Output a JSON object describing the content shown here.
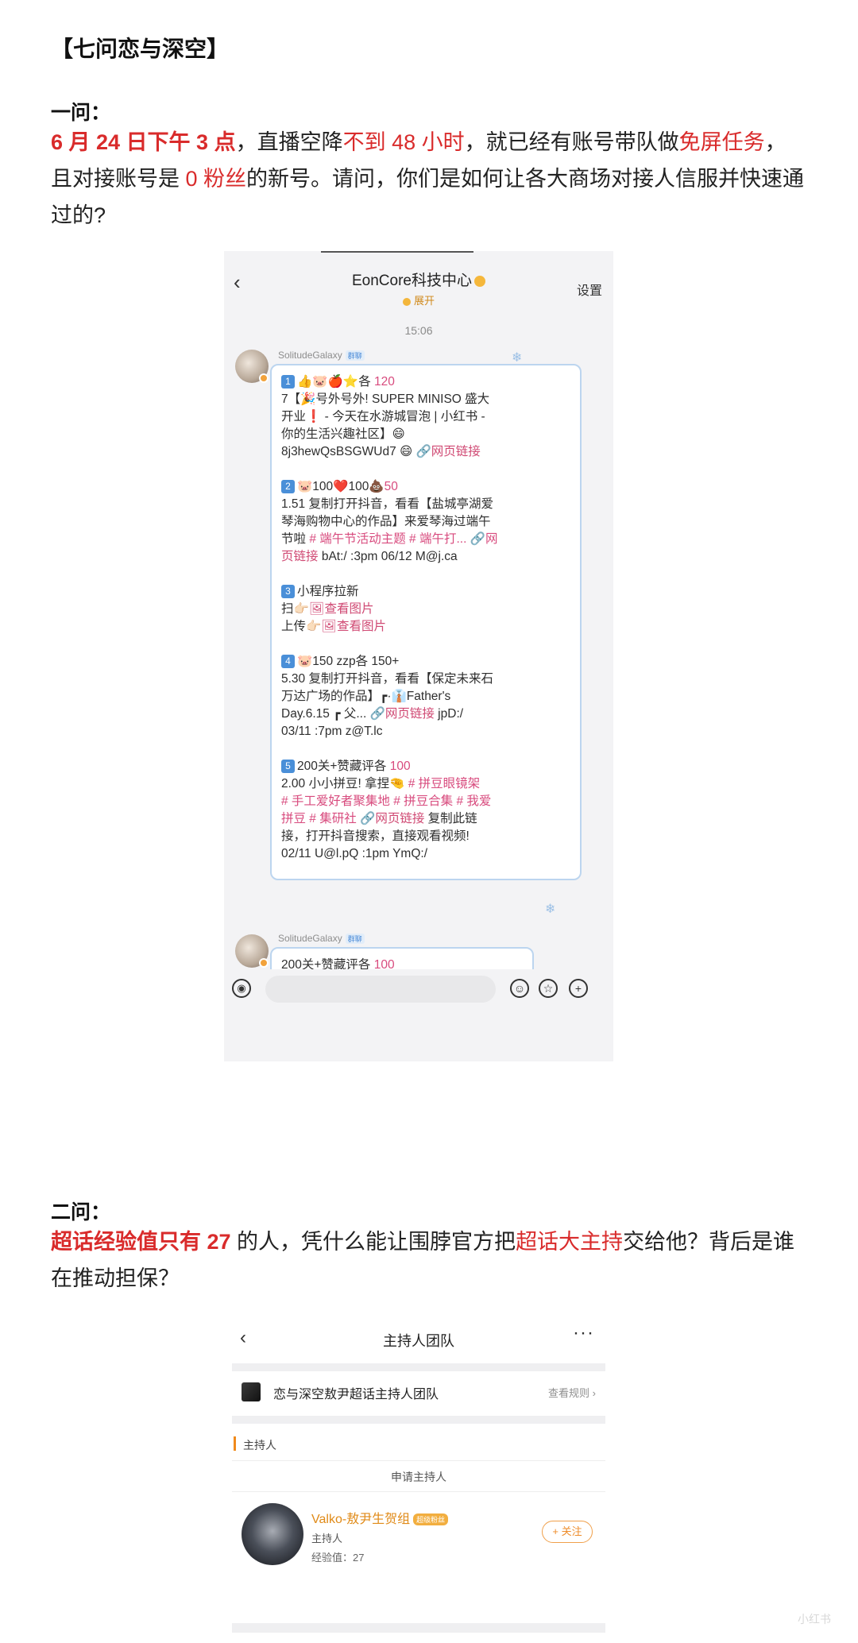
{
  "doc": {
    "title": "【七问恋与深空】"
  },
  "q1": {
    "heading": "一问：",
    "p1": "6 月 24 日下午 3 点",
    "p2": "，直播空降",
    "p3": "不到 48 小时",
    "p4": "，就已经有账号带队做",
    "p5": "免屏任务",
    "p6": "，",
    "p7": "且对接账号是 ",
    "p8": "0 粉丝",
    "p9": "的新号。请问，你们是如何让各大商场对接人信服并快速通",
    "p10": "过的?"
  },
  "chat": {
    "title": "EonCore科技中心",
    "subtitle": "展开",
    "settings": "设置",
    "back": "‹",
    "time": "15:06",
    "sender": "SolitudeGalaxy",
    "sender_tag": "群聊",
    "b1": {
      "n": "1",
      "l1": "👍🐷🍎⭐各 ",
      "l1v": "120",
      "l2": "7【🎉号外号外! SUPER MINISO 盛大",
      "l3": "开业❗ - 今天在水游城冒泡 | 小红书 -",
      "l4": "你的生活兴趣社区】😄",
      "l5": "8j3hewQsBSGWUd7 😄 ",
      "l5link": "🔗网页链接"
    },
    "b2": {
      "n": "2",
      "l1": "🐷100❤️100💩",
      "l1v": "50",
      "l2": "1.51 复制打开抖音，看看【盐城亭湖爱",
      "l3": "琴海购物中心的作品】来爱琴海过端午",
      "l4": "节啦 ",
      "l4tags": "# 端午节活动主题 # 端午打... 🔗网",
      "l5link": "页链接",
      "l5": " bAt:/ :3pm 06/12 M@j.ca"
    },
    "b3": {
      "n": "3",
      "l1": "小程序拉新",
      "l2": "扫👉🏻",
      "l2link": "🖼查看图片",
      "l3": "上传👉🏻",
      "l3link": "🖼查看图片"
    },
    "b4": {
      "n": "4",
      "l1": "🐷150  zzp各 150+",
      "l2": "5.30 复制打开抖音，看看【保定未来石",
      "l3": "万达广场的作品】┏·👔Father's",
      "l4": "Day.6.15  ┏ 父... ",
      "l4link": "🔗网页链接",
      "l4b": " jpD:/",
      "l5": "03/11 :7pm z@T.lc"
    },
    "b5": {
      "n": "5",
      "l1": "200关+赞藏评各 ",
      "l1v": "100",
      "l2": "2.00 小小拼豆! 拿捏🤏 ",
      "l2tags": "# 拼豆眼镜架",
      "l3tags": "# 手工爱好者聚集地 # 拼豆合集 # 我爱",
      "l4tags": "拼豆 # 集研社 ",
      "l4link": "🔗网页链接",
      "l4": " 复制此链",
      "l5": "接，打开抖音搜索，直接观看视频!",
      "l6": "02/11 U@l.pQ :1pm YmQ:/"
    },
    "b6": {
      "l1": "200关+赞藏评各 ",
      "l1v": "100"
    }
  },
  "q2": {
    "heading": "二问：",
    "p1": "超话经验值只有 27",
    "p2": " 的人，凭什么能让围脖官方把",
    "p3": "超话大主持",
    "p4": "交给他？背后是谁",
    "p5": "在推动担保？"
  },
  "host": {
    "title": "主持人团队",
    "back": "‹",
    "more": "···",
    "group_name": "恋与深空敖尹超话主持人团队",
    "rules": "查看规则 ›",
    "section": "主持人",
    "apply": "申请主持人",
    "name": "Valko-敖尹生贺组",
    "badge": "超级粉丝",
    "role": "主持人",
    "exp": "经验值：27",
    "follow": "+ 关注"
  },
  "watermark": "小红书"
}
